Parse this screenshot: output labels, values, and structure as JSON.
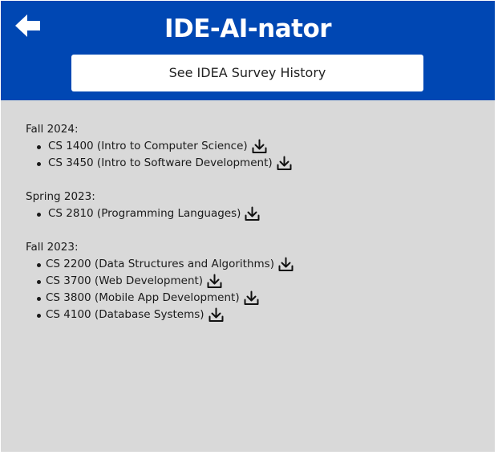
{
  "header": {
    "title": "IDE-AI-nator",
    "history_button_label": "See IDEA Survey History",
    "back_icon": "arrow-left-icon",
    "background_color": "#0047b3"
  },
  "main": {
    "background_color": "#d9d9d9",
    "download_icon": "download-icon",
    "terms": [
      {
        "label": "Fall 2024:",
        "courses": [
          "CS 1400 (Intro to Computer Science)",
          "CS 3450 (Intro to Software Development)"
        ]
      },
      {
        "label": "Spring 2023:",
        "courses": [
          "CS 2810 (Programming Languages)"
        ]
      },
      {
        "label": "Fall 2023:",
        "courses": [
          "CS 2200 (Data Structures and Algorithms)",
          "CS 3700 (Web Development)",
          "CS 3800 (Mobile App Development)",
          "CS 4100 (Database Systems)"
        ]
      }
    ]
  }
}
